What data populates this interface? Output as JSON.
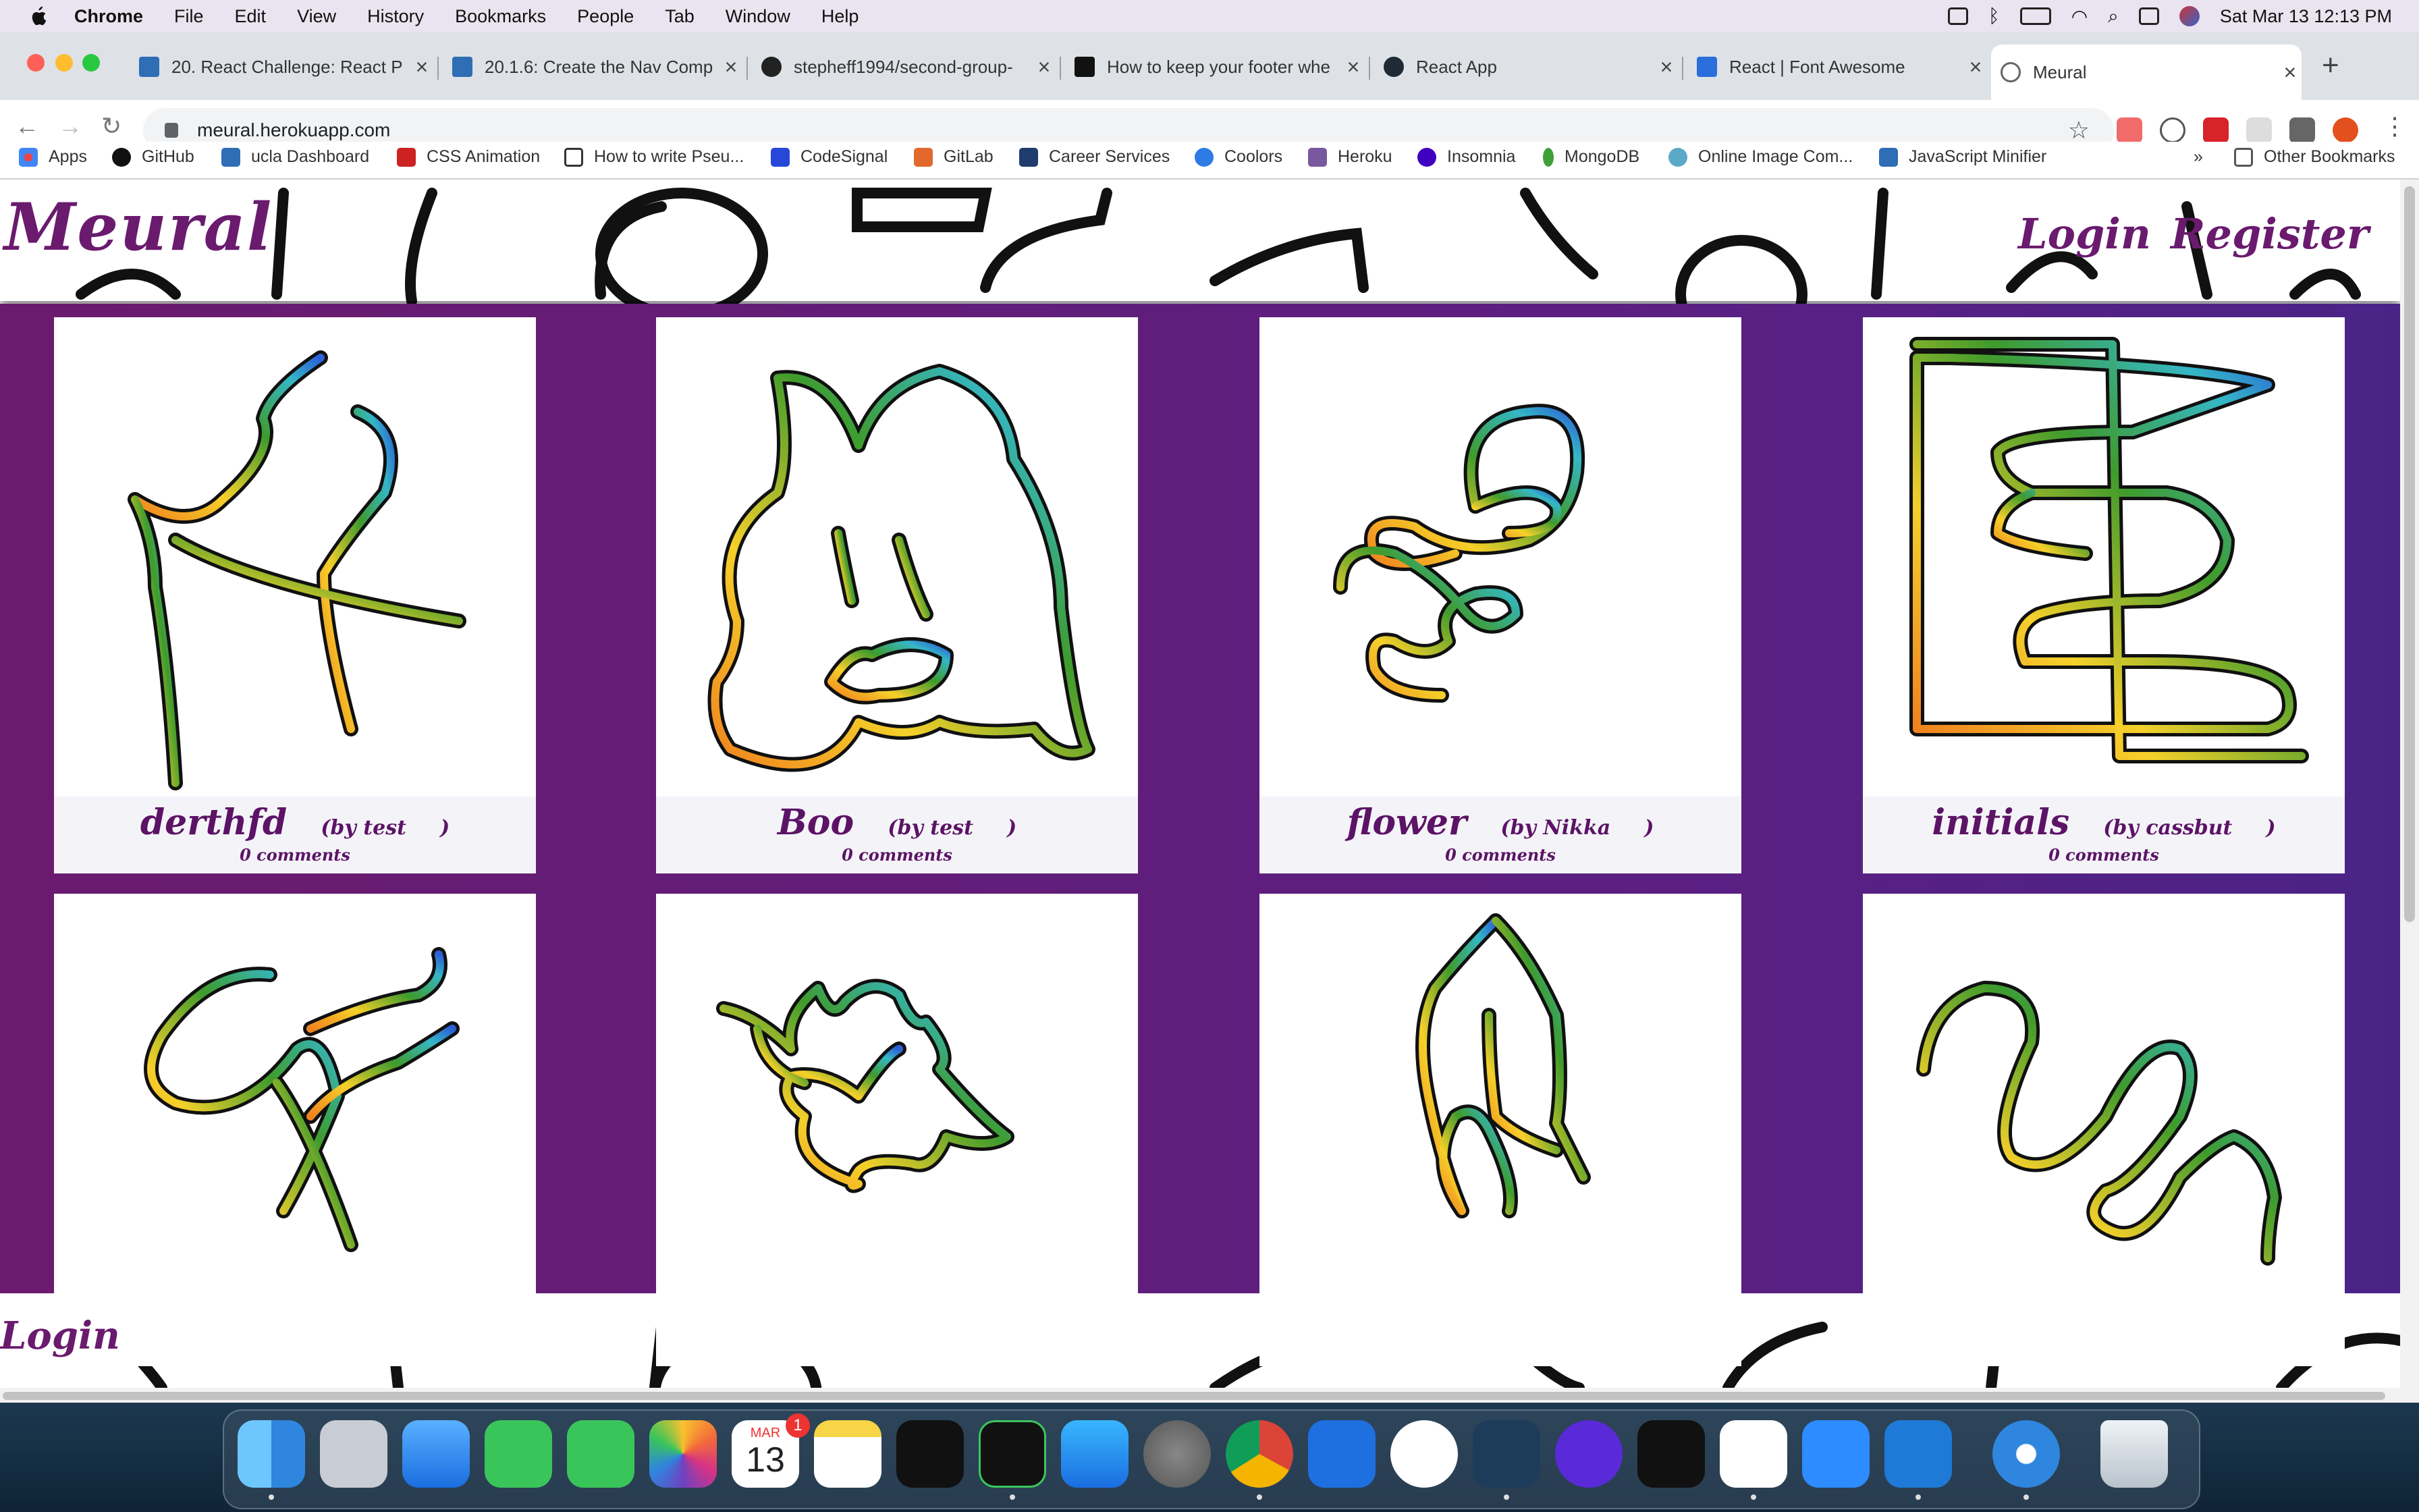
{
  "menubar": {
    "app": "Chrome",
    "items": [
      "File",
      "Edit",
      "View",
      "History",
      "Bookmarks",
      "People",
      "Tab",
      "Window",
      "Help"
    ],
    "datetime": "Sat Mar 13  12:13 PM"
  },
  "tabs": [
    {
      "title": "20. React Challenge: React P",
      "favicon_color": "#2f6db5"
    },
    {
      "title": "20.1.6: Create the Nav Comp",
      "favicon_color": "#2f6db5"
    },
    {
      "title": "stepheff1994/second-group-",
      "favicon_color": "#222222"
    },
    {
      "title": "How to keep your footer whe",
      "favicon_color": "#111111"
    },
    {
      "title": "React App",
      "favicon_color": "#1f2a36"
    },
    {
      "title": "React | Font Awesome",
      "favicon_color": "#2a6fdb"
    },
    {
      "title": "Meural",
      "favicon_color": "#666666",
      "active": true
    }
  ],
  "url": "meural.herokuapp.com",
  "bookmarks": [
    {
      "label": "Apps",
      "icon": "apps-grid-icon",
      "color": "#e44"
    },
    {
      "label": "GitHub",
      "icon": "github-icon",
      "color": "#111"
    },
    {
      "label": "ucla Dashboard",
      "icon": "ucla-icon",
      "color": "#2f6db5"
    },
    {
      "label": "CSS Animation",
      "icon": "css-animation-icon",
      "color": "#c22"
    },
    {
      "label": "How to write Pseu...",
      "icon": "bracket-icon",
      "color": "#333"
    },
    {
      "label": "CodeSignal",
      "icon": "codesignal-icon",
      "color": "#2747d8"
    },
    {
      "label": "GitLab",
      "icon": "gitlab-icon",
      "color": "#e2692b"
    },
    {
      "label": "Career Services",
      "icon": "cs-icon",
      "color": "#1f3c6e"
    },
    {
      "label": "Coolors",
      "icon": "coolors-icon",
      "color": "#2d7be5"
    },
    {
      "label": "Heroku",
      "icon": "heroku-icon",
      "color": "#79589f"
    },
    {
      "label": "Insomnia",
      "icon": "insomnia-icon",
      "color": "#4000bf"
    },
    {
      "label": "MongoDB",
      "icon": "mongodb-icon",
      "color": "#3fa037"
    },
    {
      "label": "Online Image Com...",
      "icon": "cloud-icon",
      "color": "#5aa9c7"
    },
    {
      "label": "JavaScript Minifier",
      "icon": "js-icon",
      "color": "#2f6db5"
    }
  ],
  "bookmarks_more": "»",
  "other_bookmarks": "Other Bookmarks",
  "site": {
    "brand": "Meural",
    "nav": [
      "Login",
      "Register"
    ],
    "footer_link": "Login",
    "colors": {
      "primary": "#6a1b6e",
      "gallery_right": "#4b2387"
    },
    "artworks": [
      {
        "title": "derthfd",
        "by": "(by test",
        "by_close": ")",
        "comments": "0 comments"
      },
      {
        "title": "Boo",
        "by": "(by test",
        "by_close": ")",
        "comments": "0 comments"
      },
      {
        "title": "flower",
        "by": "(by Nikka",
        "by_close": ")",
        "comments": "0 comments"
      },
      {
        "title": "initials",
        "by": "(by cassbut",
        "by_close": ")",
        "comments": "0 comments"
      },
      {
        "title": "",
        "by": "",
        "by_close": "",
        "comments": ""
      },
      {
        "title": "",
        "by": "",
        "by_close": "",
        "comments": ""
      },
      {
        "title": "",
        "by": "",
        "by_close": "",
        "comments": ""
      },
      {
        "title": "",
        "by": "",
        "by_close": "",
        "comments": ""
      }
    ]
  },
  "dock": {
    "calendar_month": "MAR",
    "calendar_day": "13",
    "calendar_badge": "1",
    "apps": [
      "finder-icon",
      "launchpad-icon",
      "mail-icon",
      "facetime-icon",
      "messages-icon",
      "photos-icon",
      "calendar-icon",
      "notes-icon",
      "apple-tv-icon",
      "parallels-icon",
      "app-store-icon",
      "system-preferences-icon",
      "chrome-icon",
      "xcode-icon",
      "mongodb-compass-icon",
      "mysql-workbench-icon",
      "insomnia-icon",
      "terminal-icon",
      "slack-icon",
      "zoom-icon",
      "vscode-icon",
      "safari-icon",
      "trash-icon"
    ]
  }
}
